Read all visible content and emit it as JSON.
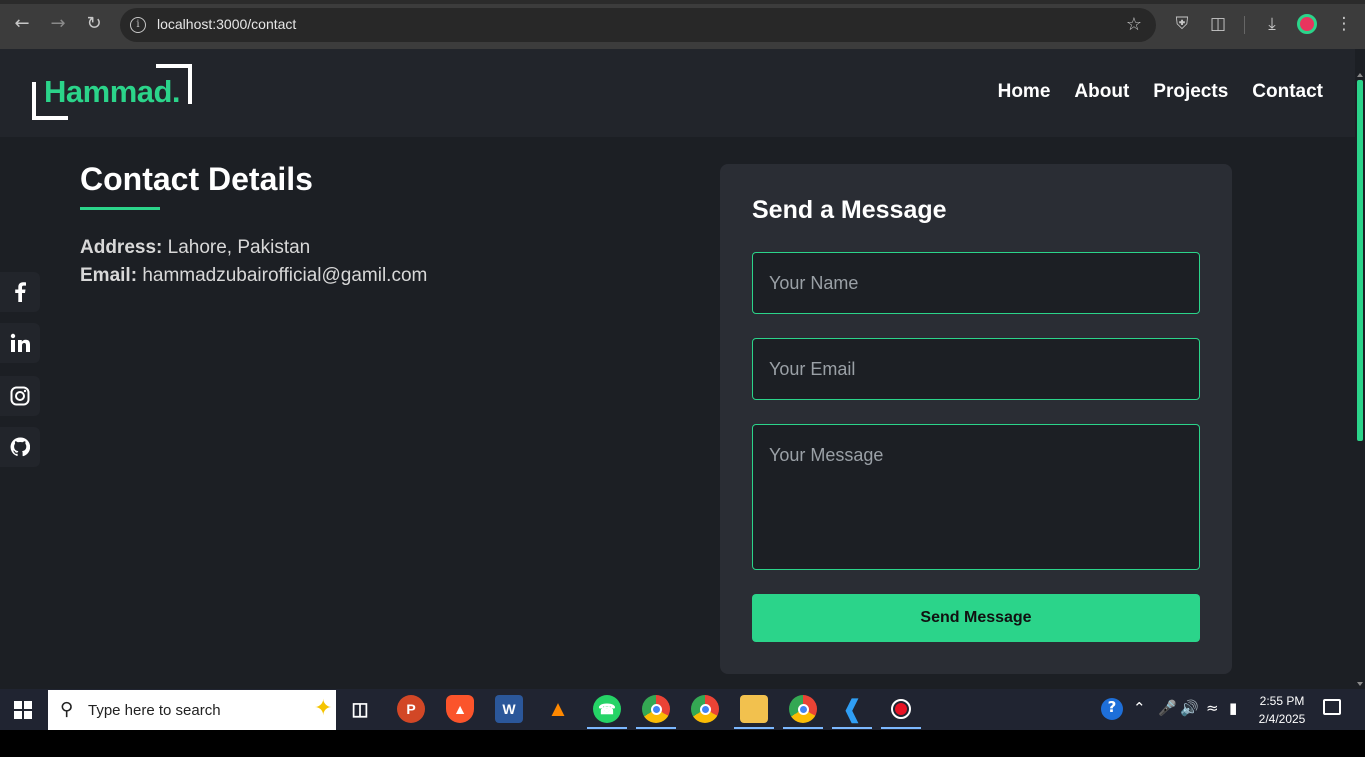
{
  "browser": {
    "url": "localhost:3000/contact"
  },
  "site": {
    "logo_text": "Hammad.",
    "nav": [
      "Home",
      "About",
      "Projects",
      "Contact"
    ]
  },
  "contact_details": {
    "title": "Contact Details",
    "address_label": "Address:",
    "address_value": "Lahore, Pakistan",
    "email_label": "Email:",
    "email_value": "hammadzubairofficial@gamil.com"
  },
  "social": [
    "facebook-icon",
    "linkedin-icon",
    "instagram-icon",
    "github-icon"
  ],
  "form": {
    "title": "Send a Message",
    "name_placeholder": "Your Name",
    "email_placeholder": "Your Email",
    "message_placeholder": "Your Message",
    "submit_label": "Send Message"
  },
  "taskbar": {
    "search_placeholder": "Type here to search",
    "time": "2:55 PM",
    "date": "2/4/2025"
  },
  "colors": {
    "accent": "#2bd48a",
    "page_bg": "#1c1f24",
    "card_bg": "#2a2d34"
  }
}
